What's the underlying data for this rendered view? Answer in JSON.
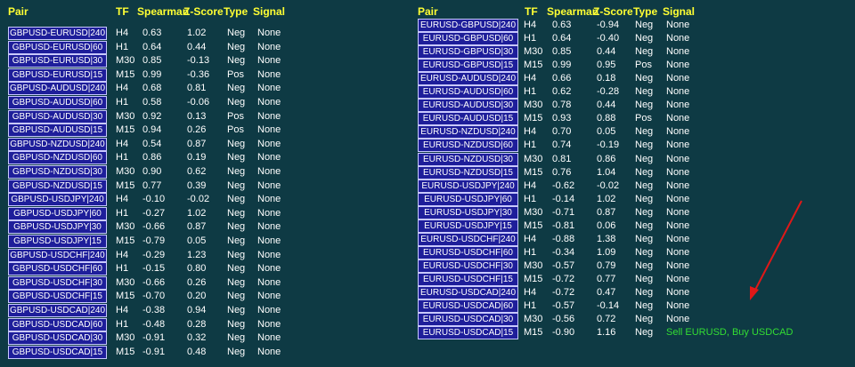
{
  "colors": {
    "background": "#0e3a44",
    "header": "#ffff33",
    "button_bg": "#1e1e9a",
    "button_border": "#c8c8ff",
    "text": "#ffffff",
    "signal_active": "#33dd33",
    "arrow": "#e01818"
  },
  "headers": {
    "pair": "Pair",
    "tf": "TF",
    "spearman": "Spearman",
    "zscore": "Z-Score",
    "type": "Type",
    "signal": "Signal"
  },
  "panels": [
    {
      "rows": [
        {
          "pair": "GBPUSD-EURUSD|240",
          "tf": "H4",
          "spearman": "0.63",
          "z": "1.02",
          "type": "Neg",
          "signal": "None"
        },
        {
          "pair": "GBPUSD-EURUSD|60",
          "tf": "H1",
          "spearman": "0.64",
          "z": "0.44",
          "type": "Neg",
          "signal": "None"
        },
        {
          "pair": "GBPUSD-EURUSD|30",
          "tf": "M30",
          "spearman": "0.85",
          "z": "-0.13",
          "type": "Neg",
          "signal": "None"
        },
        {
          "pair": "GBPUSD-EURUSD|15",
          "tf": "M15",
          "spearman": "0.99",
          "z": "-0.36",
          "type": "Pos",
          "signal": "None"
        },
        {
          "pair": "GBPUSD-AUDUSD|240",
          "tf": "H4",
          "spearman": "0.68",
          "z": "0.81",
          "type": "Neg",
          "signal": "None"
        },
        {
          "pair": "GBPUSD-AUDUSD|60",
          "tf": "H1",
          "spearman": "0.58",
          "z": "-0.06",
          "type": "Neg",
          "signal": "None"
        },
        {
          "pair": "GBPUSD-AUDUSD|30",
          "tf": "M30",
          "spearman": "0.92",
          "z": "0.13",
          "type": "Pos",
          "signal": "None"
        },
        {
          "pair": "GBPUSD-AUDUSD|15",
          "tf": "M15",
          "spearman": "0.94",
          "z": "0.26",
          "type": "Pos",
          "signal": "None"
        },
        {
          "pair": "GBPUSD-NZDUSD|240",
          "tf": "H4",
          "spearman": "0.54",
          "z": "0.87",
          "type": "Neg",
          "signal": "None"
        },
        {
          "pair": "GBPUSD-NZDUSD|60",
          "tf": "H1",
          "spearman": "0.86",
          "z": "0.19",
          "type": "Neg",
          "signal": "None"
        },
        {
          "pair": "GBPUSD-NZDUSD|30",
          "tf": "M30",
          "spearman": "0.90",
          "z": "0.62",
          "type": "Neg",
          "signal": "None"
        },
        {
          "pair": "GBPUSD-NZDUSD|15",
          "tf": "M15",
          "spearman": "0.77",
          "z": "0.39",
          "type": "Neg",
          "signal": "None"
        },
        {
          "pair": "GBPUSD-USDJPY|240",
          "tf": "H4",
          "spearman": "-0.10",
          "z": "-0.02",
          "type": "Neg",
          "signal": "None"
        },
        {
          "pair": "GBPUSD-USDJPY|60",
          "tf": "H1",
          "spearman": "-0.27",
          "z": "1.02",
          "type": "Neg",
          "signal": "None"
        },
        {
          "pair": "GBPUSD-USDJPY|30",
          "tf": "M30",
          "spearman": "-0.66",
          "z": "0.87",
          "type": "Neg",
          "signal": "None"
        },
        {
          "pair": "GBPUSD-USDJPY|15",
          "tf": "M15",
          "spearman": "-0.79",
          "z": "0.05",
          "type": "Neg",
          "signal": "None"
        },
        {
          "pair": "GBPUSD-USDCHF|240",
          "tf": "H4",
          "spearman": "-0.29",
          "z": "1.23",
          "type": "Neg",
          "signal": "None"
        },
        {
          "pair": "GBPUSD-USDCHF|60",
          "tf": "H1",
          "spearman": "-0.15",
          "z": "0.80",
          "type": "Neg",
          "signal": "None"
        },
        {
          "pair": "GBPUSD-USDCHF|30",
          "tf": "M30",
          "spearman": "-0.66",
          "z": "0.26",
          "type": "Neg",
          "signal": "None"
        },
        {
          "pair": "GBPUSD-USDCHF|15",
          "tf": "M15",
          "spearman": "-0.70",
          "z": "0.20",
          "type": "Neg",
          "signal": "None"
        },
        {
          "pair": "GBPUSD-USDCAD|240",
          "tf": "H4",
          "spearman": "-0.38",
          "z": "0.94",
          "type": "Neg",
          "signal": "None"
        },
        {
          "pair": "GBPUSD-USDCAD|60",
          "tf": "H1",
          "spearman": "-0.48",
          "z": "0.28",
          "type": "Neg",
          "signal": "None"
        },
        {
          "pair": "GBPUSD-USDCAD|30",
          "tf": "M30",
          "spearman": "-0.91",
          "z": "0.32",
          "type": "Neg",
          "signal": "None"
        },
        {
          "pair": "GBPUSD-USDCAD|15",
          "tf": "M15",
          "spearman": "-0.91",
          "z": "0.48",
          "type": "Neg",
          "signal": "None"
        }
      ]
    },
    {
      "rows": [
        {
          "pair": "EURUSD-GBPUSD|240",
          "tf": "H4",
          "spearman": "0.63",
          "z": "-0.94",
          "type": "Neg",
          "signal": "None"
        },
        {
          "pair": "EURUSD-GBPUSD|60",
          "tf": "H1",
          "spearman": "0.64",
          "z": "-0.40",
          "type": "Neg",
          "signal": "None"
        },
        {
          "pair": "EURUSD-GBPUSD|30",
          "tf": "M30",
          "spearman": "0.85",
          "z": "0.44",
          "type": "Neg",
          "signal": "None"
        },
        {
          "pair": "EURUSD-GBPUSD|15",
          "tf": "M15",
          "spearman": "0.99",
          "z": "0.95",
          "type": "Pos",
          "signal": "None"
        },
        {
          "pair": "EURUSD-AUDUSD|240",
          "tf": "H4",
          "spearman": "0.66",
          "z": "0.18",
          "type": "Neg",
          "signal": "None"
        },
        {
          "pair": "EURUSD-AUDUSD|60",
          "tf": "H1",
          "spearman": "0.62",
          "z": "-0.28",
          "type": "Neg",
          "signal": "None"
        },
        {
          "pair": "EURUSD-AUDUSD|30",
          "tf": "M30",
          "spearman": "0.78",
          "z": "0.44",
          "type": "Neg",
          "signal": "None"
        },
        {
          "pair": "EURUSD-AUDUSD|15",
          "tf": "M15",
          "spearman": "0.93",
          "z": "0.88",
          "type": "Pos",
          "signal": "None"
        },
        {
          "pair": "EURUSD-NZDUSD|240",
          "tf": "H4",
          "spearman": "0.70",
          "z": "0.05",
          "type": "Neg",
          "signal": "None"
        },
        {
          "pair": "EURUSD-NZDUSD|60",
          "tf": "H1",
          "spearman": "0.74",
          "z": "-0.19",
          "type": "Neg",
          "signal": "None"
        },
        {
          "pair": "EURUSD-NZDUSD|30",
          "tf": "M30",
          "spearman": "0.81",
          "z": "0.86",
          "type": "Neg",
          "signal": "None"
        },
        {
          "pair": "EURUSD-NZDUSD|15",
          "tf": "M15",
          "spearman": "0.76",
          "z": "1.04",
          "type": "Neg",
          "signal": "None"
        },
        {
          "pair": "EURUSD-USDJPY|240",
          "tf": "H4",
          "spearman": "-0.62",
          "z": "-0.02",
          "type": "Neg",
          "signal": "None"
        },
        {
          "pair": "EURUSD-USDJPY|60",
          "tf": "H1",
          "spearman": "-0.14",
          "z": "1.02",
          "type": "Neg",
          "signal": "None"
        },
        {
          "pair": "EURUSD-USDJPY|30",
          "tf": "M30",
          "spearman": "-0.71",
          "z": "0.87",
          "type": "Neg",
          "signal": "None"
        },
        {
          "pair": "EURUSD-USDJPY|15",
          "tf": "M15",
          "spearman": "-0.81",
          "z": "0.06",
          "type": "Neg",
          "signal": "None"
        },
        {
          "pair": "EURUSD-USDCHF|240",
          "tf": "H4",
          "spearman": "-0.88",
          "z": "1.38",
          "type": "Neg",
          "signal": "None"
        },
        {
          "pair": "EURUSD-USDCHF|60",
          "tf": "H1",
          "spearman": "-0.34",
          "z": "1.09",
          "type": "Neg",
          "signal": "None"
        },
        {
          "pair": "EURUSD-USDCHF|30",
          "tf": "M30",
          "spearman": "-0.57",
          "z": "0.79",
          "type": "Neg",
          "signal": "None"
        },
        {
          "pair": "EURUSD-USDCHF|15",
          "tf": "M15",
          "spearman": "-0.72",
          "z": "0.77",
          "type": "Neg",
          "signal": "None"
        },
        {
          "pair": "EURUSD-USDCAD|240",
          "tf": "H4",
          "spearman": "-0.72",
          "z": "0.47",
          "type": "Neg",
          "signal": "None"
        },
        {
          "pair": "EURUSD-USDCAD|60",
          "tf": "H1",
          "spearman": "-0.57",
          "z": "-0.14",
          "type": "Neg",
          "signal": "None"
        },
        {
          "pair": "EURUSD-USDCAD|30",
          "tf": "M30",
          "spearman": "-0.56",
          "z": "0.72",
          "type": "Neg",
          "signal": "None"
        },
        {
          "pair": "EURUSD-USDCAD|15",
          "tf": "M15",
          "spearman": "-0.90",
          "z": "1.16",
          "type": "Neg",
          "signal": "Sell EURUSD, Buy USDCAD",
          "signal_active": true
        }
      ]
    }
  ]
}
